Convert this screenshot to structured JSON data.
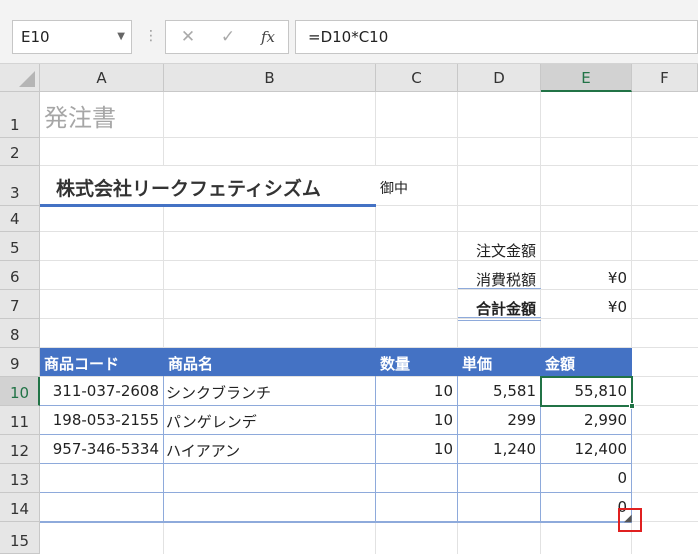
{
  "formula_bar": {
    "name_box": "E10",
    "cancel_glyph": "✕",
    "enter_glyph": "✓",
    "fx_label": "fx",
    "formula": "=D10*C10"
  },
  "columns": [
    "A",
    "B",
    "C",
    "D",
    "E",
    "F"
  ],
  "rows": [
    "1",
    "2",
    "3",
    "4",
    "5",
    "6",
    "7",
    "8",
    "9",
    "10",
    "11",
    "12",
    "13",
    "14",
    "15"
  ],
  "sheet": {
    "title": "発注書",
    "company": "株式会社リークフェティシズム",
    "honorific": "御中",
    "summary": [
      {
        "label": "注文金額",
        "value": ""
      },
      {
        "label": "消費税額",
        "value": "¥0"
      },
      {
        "label": "合計金額",
        "value": "¥0"
      }
    ],
    "table_headers": [
      "商品コード",
      "商品名",
      "数量",
      "単価",
      "金額"
    ],
    "table_rows": [
      {
        "code": "311-037-2608",
        "name": "シンクブランチ",
        "qty": "10",
        "price": "5,581",
        "amount": "55,810"
      },
      {
        "code": "198-053-2155",
        "name": "パンゲレンデ",
        "qty": "10",
        "price": "299",
        "amount": "2,990"
      },
      {
        "code": "957-346-5334",
        "name": "ハイアアン",
        "qty": "10",
        "price": "1,240",
        "amount": "12,400"
      },
      {
        "code": "",
        "name": "",
        "qty": "",
        "price": "",
        "amount": "0"
      },
      {
        "code": "",
        "name": "",
        "qty": "",
        "price": "",
        "amount": "0"
      }
    ]
  },
  "colors": {
    "header_fill": "#4472c4",
    "active_border": "#217346",
    "highlight_box": "#e02020"
  }
}
